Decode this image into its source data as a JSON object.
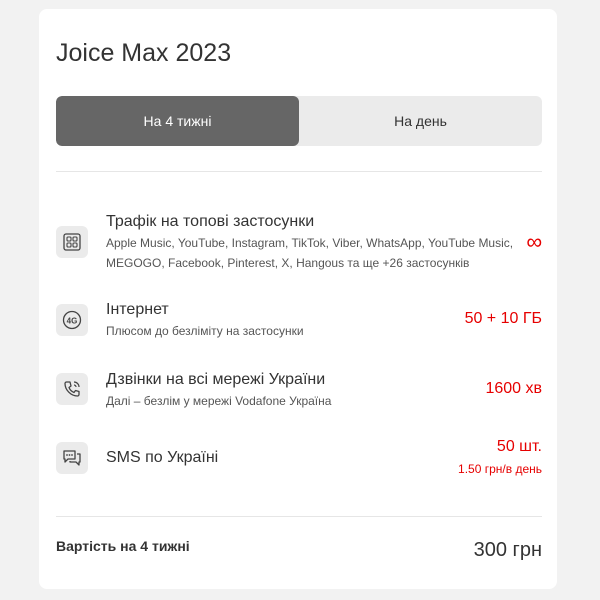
{
  "plan": {
    "title": "Joice Max 2023"
  },
  "tabs": [
    {
      "label": "На 4 тижні",
      "active": true
    },
    {
      "label": "На день",
      "active": false
    }
  ],
  "features": [
    {
      "icon": "apps-grid-icon",
      "title": "Трафік на топові застосунки",
      "subtitle": "Apple Music, YouTube, Instagram, TikTok, Viber, WhatsApp, YouTube Music, MEGOGO, Facebook, Pinterest, X, Hangous та ще +26 застосунків",
      "value": "∞",
      "value_sub": ""
    },
    {
      "icon": "4g-icon",
      "title": "Інтернет",
      "subtitle": "Плюсом до безліміту на застосунки",
      "value": "50 + 10 ГБ",
      "value_sub": ""
    },
    {
      "icon": "phone-call-icon",
      "title": "Дзвінки на всі мережі України",
      "subtitle": "Далі – безлім у мережі Vodafone Україна",
      "value": "1600 хв",
      "value_sub": ""
    },
    {
      "icon": "sms-chat-icon",
      "title": "SMS по Україні",
      "subtitle": "",
      "value": "50 шт.",
      "value_sub": "1.50 грн/в день"
    }
  ],
  "footer": {
    "label": "Вартість на 4 тижні",
    "price": "300 грн"
  },
  "colors": {
    "accent": "#e60000",
    "tab_active": "#666666",
    "tab_inactive": "#ebebeb",
    "icon_bg": "#ebebeb",
    "page_bg": "#f2f2f2"
  }
}
